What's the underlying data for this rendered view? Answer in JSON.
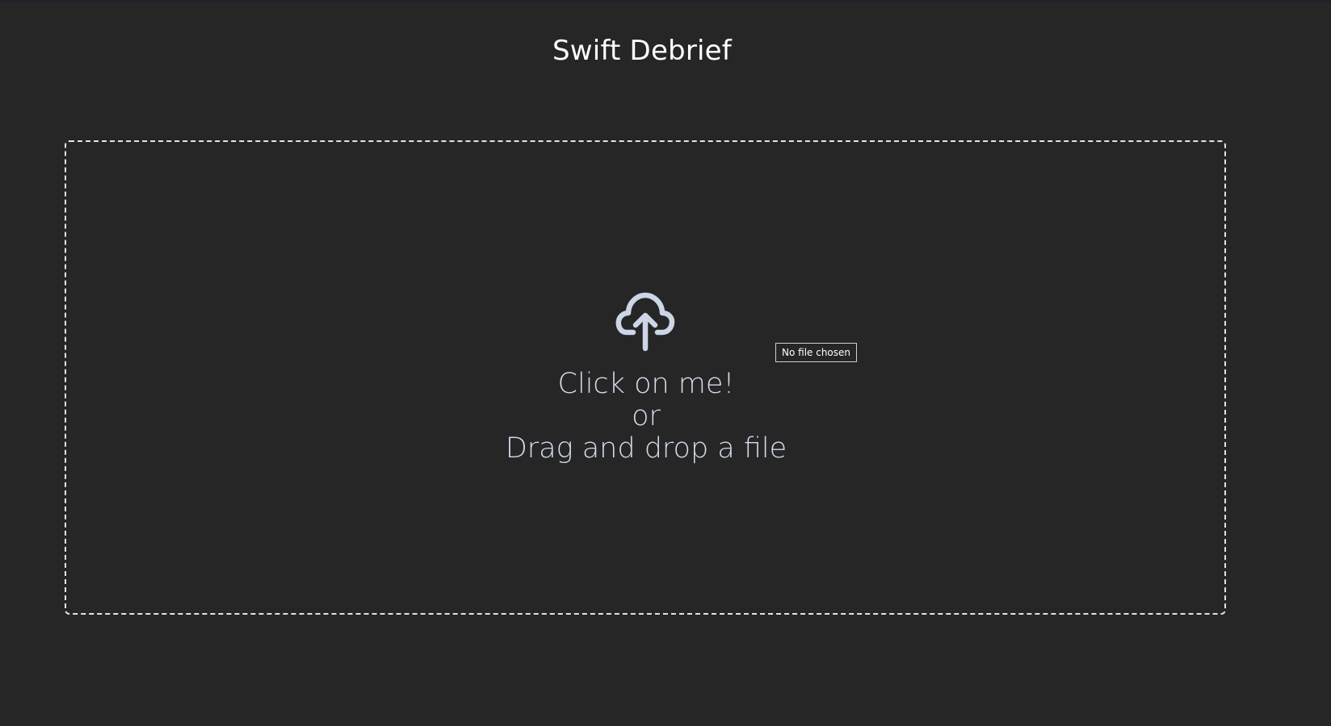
{
  "header": {
    "title": "Swift Debrief"
  },
  "upload": {
    "icon": "cloud-upload-icon",
    "line1": "Click on me!",
    "line2": "or",
    "line3": "Drag and drop a file",
    "file_status": "No file chosen"
  },
  "colors": {
    "background": "#262626",
    "title": "#ffffff",
    "accent_text": "#d3dbeb",
    "dashed_border": "#e4e4e4"
  }
}
